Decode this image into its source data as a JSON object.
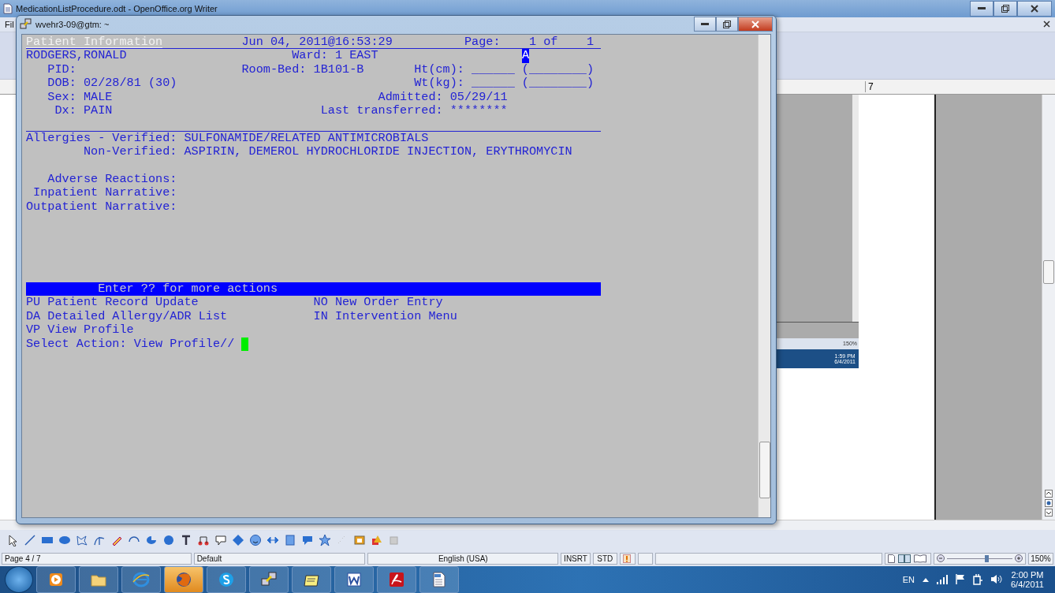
{
  "writer_window": {
    "title": "MedicationListProcedure.odt - OpenOffice.org Writer",
    "menu": [
      "Fil"
    ],
    "ruler_label": "7",
    "embedded_screenshot": {
      "zoom": "150%",
      "time": "1:59 PM",
      "date": "6/4/2011"
    },
    "status_bar": {
      "page": "Page 4 / 7",
      "page_style": "Default",
      "language": "English (USA)",
      "insert_mode": "INSRT",
      "selection_mode": "STD",
      "zoom_slider": {
        "level": 0.6
      },
      "zoom": "150%"
    }
  },
  "terminal_window": {
    "title": "wvehr3-09@gtm: ~",
    "lines": [
      {
        "kind": "underlined",
        "segments": [
          {
            "kind": "title",
            "text": "Patient Information"
          },
          {
            "kind": "plain",
            "text": "           Jun 04, 2011@16:53:29          Page:    1 of    1 "
          }
        ]
      },
      {
        "kind": "text",
        "segments": [
          {
            "kind": "plain",
            "text": "RODGERS,RONALD                       Ward: 1 EAST                    "
          },
          {
            "kind": "reverse",
            "text": "A"
          }
        ]
      },
      {
        "kind": "text",
        "segments": [
          {
            "kind": "plain",
            "text": "   PID:                       Room-Bed: 1B101-B       Ht(cm): ______ (________)"
          }
        ]
      },
      {
        "kind": "text",
        "segments": [
          {
            "kind": "plain",
            "text": "   DOB: 02/28/81 (30)                                 Wt(kg): ______ (________)"
          }
        ]
      },
      {
        "kind": "text",
        "segments": [
          {
            "kind": "plain",
            "text": "   Sex: MALE                                     Admitted: 05/29/11"
          }
        ]
      },
      {
        "kind": "text",
        "segments": [
          {
            "kind": "plain",
            "text": "    Dx: PAIN                             Last transferred: ********"
          }
        ]
      },
      {
        "kind": "rule"
      },
      {
        "kind": "text",
        "segments": [
          {
            "kind": "plain",
            "text": "Allergies - Verified: SULFONAMIDE/RELATED ANTIMICROBIALS"
          }
        ]
      },
      {
        "kind": "text",
        "segments": [
          {
            "kind": "plain",
            "text": "        Non-Verified: ASPIRIN, DEMEROL HYDROCHLORIDE INJECTION, ERYTHROMYCIN"
          }
        ]
      },
      {
        "kind": "blank"
      },
      {
        "kind": "text",
        "segments": [
          {
            "kind": "plain",
            "text": "   Adverse Reactions:"
          }
        ]
      },
      {
        "kind": "text",
        "segments": [
          {
            "kind": "plain",
            "text": " Inpatient Narrative:"
          }
        ]
      },
      {
        "kind": "text",
        "segments": [
          {
            "kind": "plain",
            "text": "Outpatient Narrative:"
          }
        ]
      },
      {
        "kind": "blank"
      },
      {
        "kind": "blank"
      },
      {
        "kind": "blank"
      },
      {
        "kind": "blank"
      },
      {
        "kind": "blank"
      },
      {
        "kind": "bar",
        "segments": [
          {
            "kind": "plain",
            "text": "          Enter ?? for more actions"
          }
        ]
      },
      {
        "kind": "text",
        "segments": [
          {
            "kind": "plain",
            "text": "PU Patient Record Update                NO New Order Entry"
          }
        ]
      },
      {
        "kind": "text",
        "segments": [
          {
            "kind": "plain",
            "text": "DA Detailed Allergy/ADR List            IN Intervention Menu"
          }
        ]
      },
      {
        "kind": "text",
        "segments": [
          {
            "kind": "plain",
            "text": "VP View Profile"
          }
        ]
      },
      {
        "kind": "text",
        "segments": [
          {
            "kind": "plain",
            "text": "Select Action: View Profile// "
          },
          {
            "kind": "cursor"
          }
        ]
      }
    ]
  },
  "taskbar": {
    "apps": [
      {
        "kind": "media",
        "selected": false
      },
      {
        "kind": "folder",
        "selected": false
      },
      {
        "kind": "browser",
        "selected": false
      },
      {
        "kind": "globe",
        "selected": true
      },
      {
        "kind": "chat",
        "selected": false
      },
      {
        "kind": "terminal",
        "selected": false
      },
      {
        "kind": "notepad",
        "selected": false
      },
      {
        "kind": "word",
        "selected": false
      },
      {
        "kind": "pdf",
        "selected": false
      },
      {
        "kind": "file",
        "selected": false
      }
    ],
    "language": "EN",
    "time": "2:00 PM",
    "date": "6/4/2011"
  }
}
